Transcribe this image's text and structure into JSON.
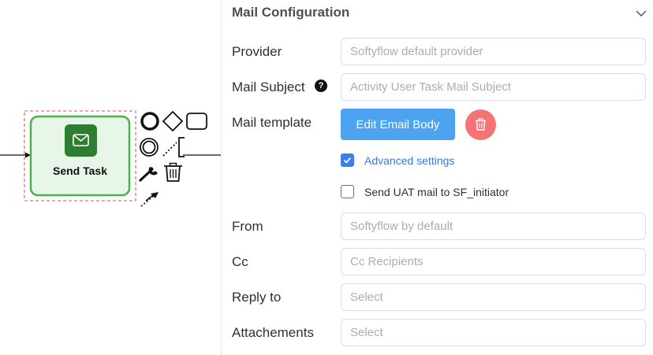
{
  "canvas": {
    "task_label": "Send Task"
  },
  "panel": {
    "section_title": "Mail Configuration",
    "fields": {
      "provider": {
        "label": "Provider",
        "placeholder": "Softyflow default provider"
      },
      "mail_subject": {
        "label": "Mail Subject",
        "placeholder": "Activity User Task Mail Subject",
        "help_glyph": "?"
      },
      "mail_template": {
        "label": "Mail template",
        "button_label": "Edit Email Body"
      },
      "from": {
        "label": "From",
        "placeholder": "Softyflow by default"
      },
      "cc": {
        "label": "Cc",
        "placeholder": "Cc Recipients"
      },
      "reply_to": {
        "label": "Reply to",
        "placeholder": "Select"
      },
      "attachments": {
        "label": "Attachements",
        "placeholder": "Select"
      }
    },
    "advanced_settings": {
      "label": "Advanced settings",
      "checked": true
    },
    "send_uat": {
      "label": "Send UAT mail to SF_initiator",
      "checked": false
    }
  },
  "colors": {
    "primary_button": "#4da3f0",
    "delete_button": "#f47474",
    "checkbox_checked": "#3a7ff0",
    "task_border": "#4caf50",
    "task_fill": "#e8f5e9",
    "task_icon_bg": "#2e7d32"
  }
}
